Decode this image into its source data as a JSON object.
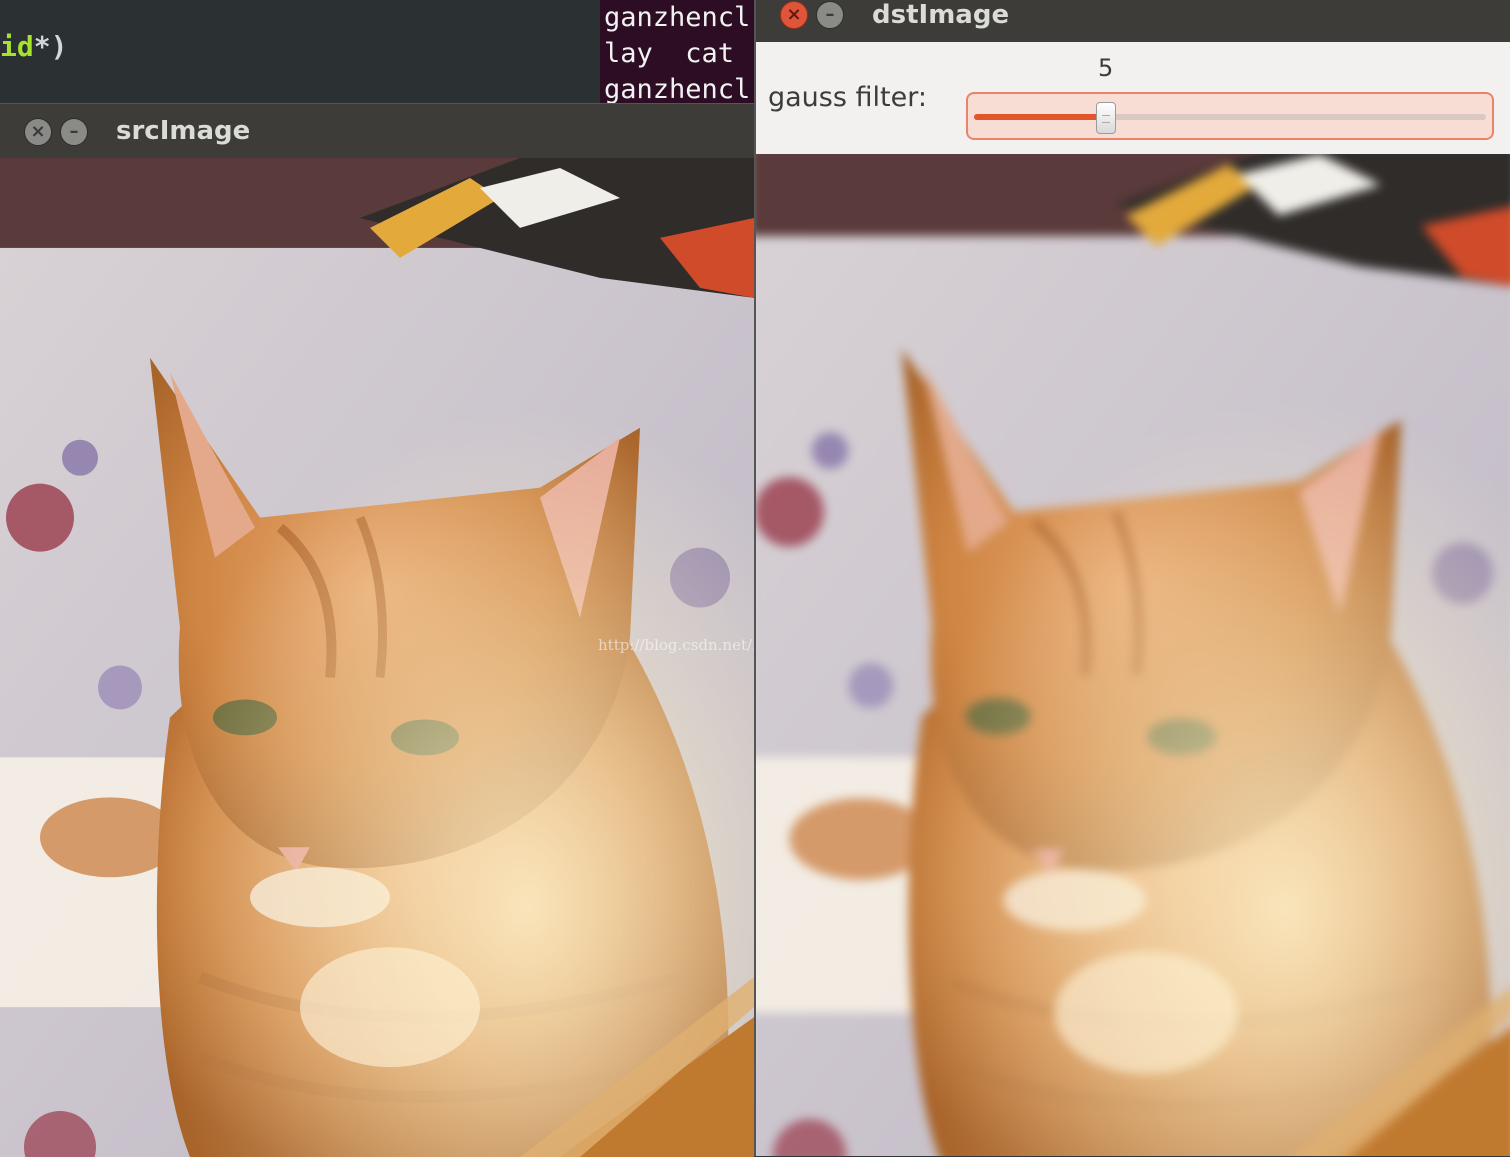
{
  "editor": {
    "code_keyword": "id",
    "code_rest": "*)"
  },
  "terminal": {
    "lines": [
      "ganzhencl",
      "lay  cat",
      "ganzhencl"
    ]
  },
  "src_window": {
    "title": "srcImage",
    "close_icon": "close-icon",
    "min_icon": "minimize-icon"
  },
  "dst_window": {
    "title": "dstImage",
    "close_icon": "close-icon",
    "min_icon": "minimize-icon",
    "trackbar": {
      "label": "gauss filter:",
      "value": "5",
      "fraction": 0.258
    }
  },
  "watermark": "http://blog.csdn.net/..."
}
